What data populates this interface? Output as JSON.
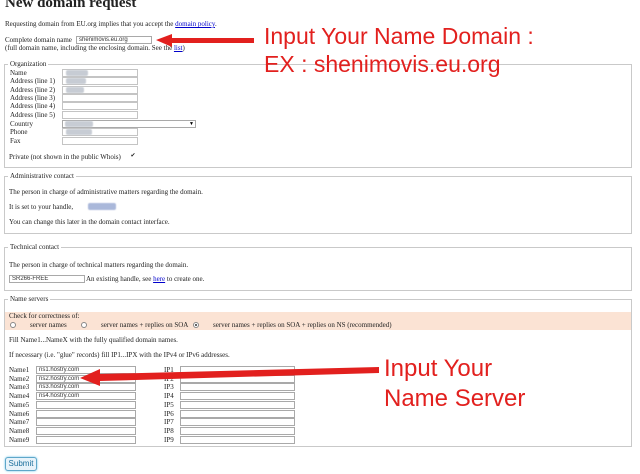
{
  "page": {
    "title": "New domain request",
    "intro": "Requesting domain from EU.org implies that you accept the",
    "intro_link": "domain policy",
    "intro_end": "."
  },
  "domain": {
    "label": "Complete domain name",
    "value": "shenimovis.eu.org",
    "hint_prefix": "(full domain name, including the enclosing domain. See the",
    "hint_link": "list",
    "hint_suffix": ")"
  },
  "organization": {
    "legend": "Organization",
    "fields": [
      "Name",
      "Address (line 1)",
      "Address (line 2)",
      "Address (line 3)",
      "Address (line 4)",
      "Address (line 5)",
      "Country",
      "Phone",
      "Fax"
    ],
    "private_label": "Private (not shown in the public Whois)",
    "private_checked": true,
    "checkbox_glyph": "✔",
    "dropdown_glyph": "▼"
  },
  "admin": {
    "legend": "Administrative contact",
    "line1": "The person in charge of administrative matters regarding the domain.",
    "line2": "It is set to your handle,",
    "line3": "You can change this later in the domain contact interface."
  },
  "tech": {
    "legend": "Technical contact",
    "line1": "The person in charge of technical matters regarding the domain.",
    "handle_value": "SR266-FREE",
    "handle_hint": "An existing handle, see",
    "handle_link": "here",
    "handle_hint_end": "to create one."
  },
  "nameservers": {
    "legend": "Name servers",
    "check_label": "Check for correctness of:",
    "options": [
      "server names",
      "server names + replies on SOA",
      "server names + replies on SOA + replies on NS (recommended)"
    ],
    "selected_index": 2,
    "fill_note": "Fill Name1...NameX with the fully qualified domain names.",
    "glue_note": "If necessary (i.e. \"glue\" records) fill IP1...IPX with the IPv4 or IPv6 addresses.",
    "rows": [
      {
        "name_label": "Name1",
        "name_value": "ns1.hostry.com",
        "ip_label": "IP1"
      },
      {
        "name_label": "Name2",
        "name_value": "ns2.hostry.com",
        "ip_label": "IP2"
      },
      {
        "name_label": "Name3",
        "name_value": "ns3.hostry.com",
        "ip_label": "IP3"
      },
      {
        "name_label": "Name4",
        "name_value": "ns4.hostry.com",
        "ip_label": "IP4"
      },
      {
        "name_label": "Name5",
        "name_value": "",
        "ip_label": "IP5"
      },
      {
        "name_label": "Name6",
        "name_value": "",
        "ip_label": "IP6"
      },
      {
        "name_label": "Name7",
        "name_value": "",
        "ip_label": "IP7"
      },
      {
        "name_label": "Name8",
        "name_value": "",
        "ip_label": "IP8"
      },
      {
        "name_label": "Name9",
        "name_value": "",
        "ip_label": "IP9"
      }
    ]
  },
  "submit_label": "Submit",
  "annotations": {
    "domain_line1": "Input Your Name Domain :",
    "domain_line2": "EX : shenimovis.eu.org",
    "ns_line1": "Input Your",
    "ns_line2": "Name Server",
    "color": "#e2201e"
  }
}
